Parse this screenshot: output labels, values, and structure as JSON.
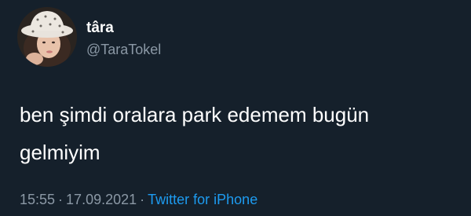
{
  "tweet": {
    "author": {
      "display_name": "târa",
      "handle": "@TaraTokel"
    },
    "text_line1": "ben şimdi oralara park edemem bugün",
    "text_line2": "gelmiyim",
    "time": "15:55",
    "separator": "·",
    "date": "17.09.2021",
    "source": "Twitter for iPhone"
  },
  "colors": {
    "background": "#15202b",
    "text": "#ffffff",
    "secondary": "#8b98a5",
    "link": "#1d9bf0"
  }
}
